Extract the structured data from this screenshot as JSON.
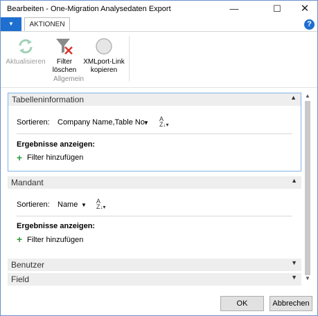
{
  "window": {
    "title": "Bearbeiten - One-Migration Analysedaten Export"
  },
  "ribbon": {
    "tab": "AKTIONEN",
    "buttons": {
      "refresh": "Aktualisieren",
      "filter_clear_line1": "Filter",
      "filter_clear_line2": "löschen",
      "xmlport_line1": "XMLport-Link",
      "xmlport_line2": "kopieren"
    },
    "group_label": "Allgemein"
  },
  "sections": {
    "table_info": {
      "title": "Tabelleninformation",
      "sort_label": "Sortieren:",
      "sort_value": "Company Name,Table No.",
      "results_label": "Ergebnisse anzeigen:",
      "add_filter": "Filter hinzufügen"
    },
    "company": {
      "title": "Mandant",
      "sort_label": "Sortieren:",
      "sort_value": "Name",
      "results_label": "Ergebnisse anzeigen:",
      "add_filter": "Filter hinzufügen"
    },
    "user": {
      "title": "Benutzer"
    },
    "field": {
      "title": "Field"
    }
  },
  "footer": {
    "ok": "OK",
    "cancel": "Abbrechen"
  }
}
